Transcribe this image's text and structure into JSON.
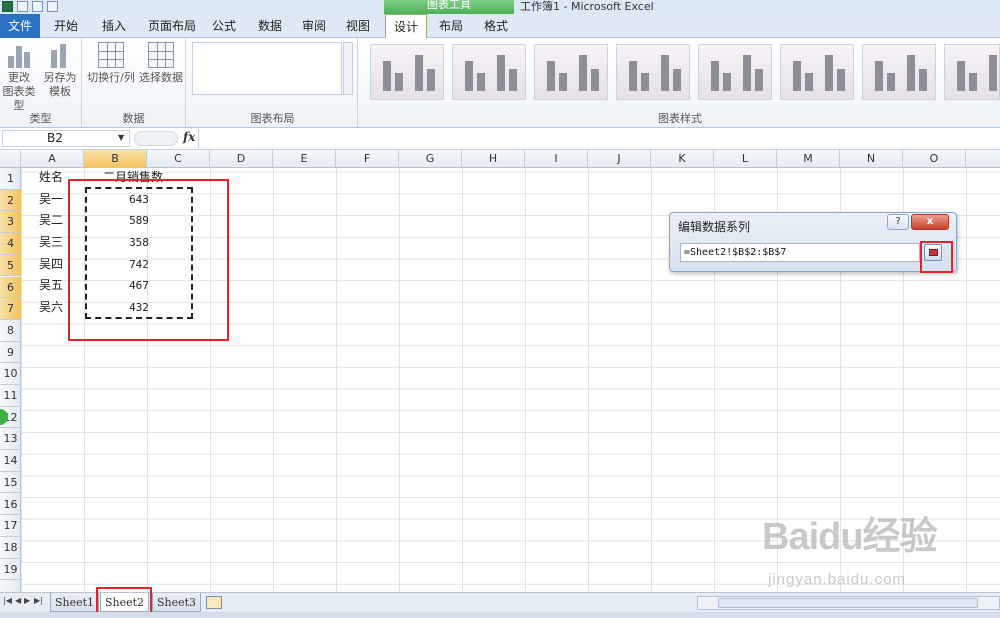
{
  "app": {
    "title": "工作簿1 - Microsoft Excel",
    "context_tab_group": "图表工具"
  },
  "ribbon": {
    "tabs": [
      {
        "label": "文件"
      },
      {
        "label": "开始"
      },
      {
        "label": "插入"
      },
      {
        "label": "页面布局"
      },
      {
        "label": "公式"
      },
      {
        "label": "数据"
      },
      {
        "label": "审阅"
      },
      {
        "label": "视图"
      },
      {
        "label": "设计"
      },
      {
        "label": "布局"
      },
      {
        "label": "格式"
      }
    ],
    "active_tab": "设计",
    "groups": {
      "type": {
        "label": "类型",
        "change_chart_type": "更改\n图表类型",
        "save_as_template": "另存为\n模板"
      },
      "data": {
        "label": "数据",
        "switch_row_col": "切换行/列",
        "select_data": "选择数据"
      },
      "layouts": {
        "label": "图表布局"
      },
      "styles": {
        "label": "图表样式"
      }
    }
  },
  "formula_bar": {
    "name_box": "B2",
    "fx_label": "fx",
    "formula": ""
  },
  "sheet": {
    "columns": [
      "A",
      "B",
      "C",
      "D",
      "E",
      "F",
      "G",
      "H",
      "I",
      "J",
      "K",
      "L",
      "M",
      "N",
      "O"
    ],
    "selected_column": "B",
    "rows": [
      "1",
      "2",
      "3",
      "4",
      "5",
      "6",
      "7",
      "8",
      "9",
      "10",
      "11",
      "12",
      "13",
      "14",
      "15",
      "16",
      "17",
      "18",
      "19"
    ],
    "cells": {
      "A1": "姓名",
      "B1": "二月销售数",
      "A2": "吴一",
      "B2": "643",
      "A3": "吴二",
      "B3": "589",
      "A4": "吴三",
      "B4": "358",
      "A5": "吴四",
      "B5": "742",
      "A6": "吴五",
      "B6": "467",
      "A7": "吴六",
      "B7": "432"
    }
  },
  "dialog": {
    "title": "编辑数据系列",
    "help_label": "?",
    "close_label": "x",
    "series_value": "=Sheet2!$B$2:$B$7"
  },
  "sheet_tabs": {
    "tabs": [
      "Sheet1",
      "Sheet2",
      "Sheet3"
    ],
    "active": "Sheet2"
  },
  "watermark": {
    "logo": "Baidu经验",
    "site": "jingyan.baidu.com"
  },
  "colors": {
    "highlight_red": "#e0242a",
    "file_tab_blue": "#2b70c2",
    "context_green": "#4fae55",
    "selected_header": "#f1c25f"
  }
}
